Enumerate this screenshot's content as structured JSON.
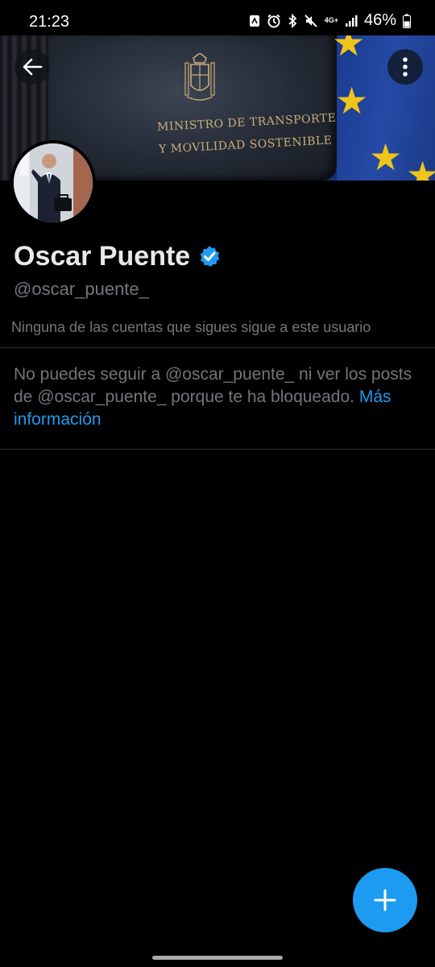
{
  "status_bar": {
    "time": "21:23",
    "network": "4G+",
    "battery": "46%"
  },
  "banner": {
    "line1": "MINISTRO DE TRANSPORTES",
    "line2": "Y MOVILIDAD SOSTENIBLE"
  },
  "profile": {
    "display_name": "Oscar Puente",
    "verified": true,
    "handle": "@oscar_puente_",
    "followers_note": "Ninguna de las cuentas que sigues sigue a este usuario"
  },
  "blocked": {
    "message": "No puedes seguir a @oscar_puente_ ni ver los posts de @oscar_puente_ porque te ha bloqueado. ",
    "link_text": "Más información"
  },
  "colors": {
    "accent": "#1d9bf0",
    "background": "#000000",
    "secondary_text": "#71767b"
  },
  "icons": {
    "back": "arrow-left-icon",
    "more": "more-vertical-icon",
    "verified": "verified-badge-icon",
    "compose": "plus-icon"
  }
}
